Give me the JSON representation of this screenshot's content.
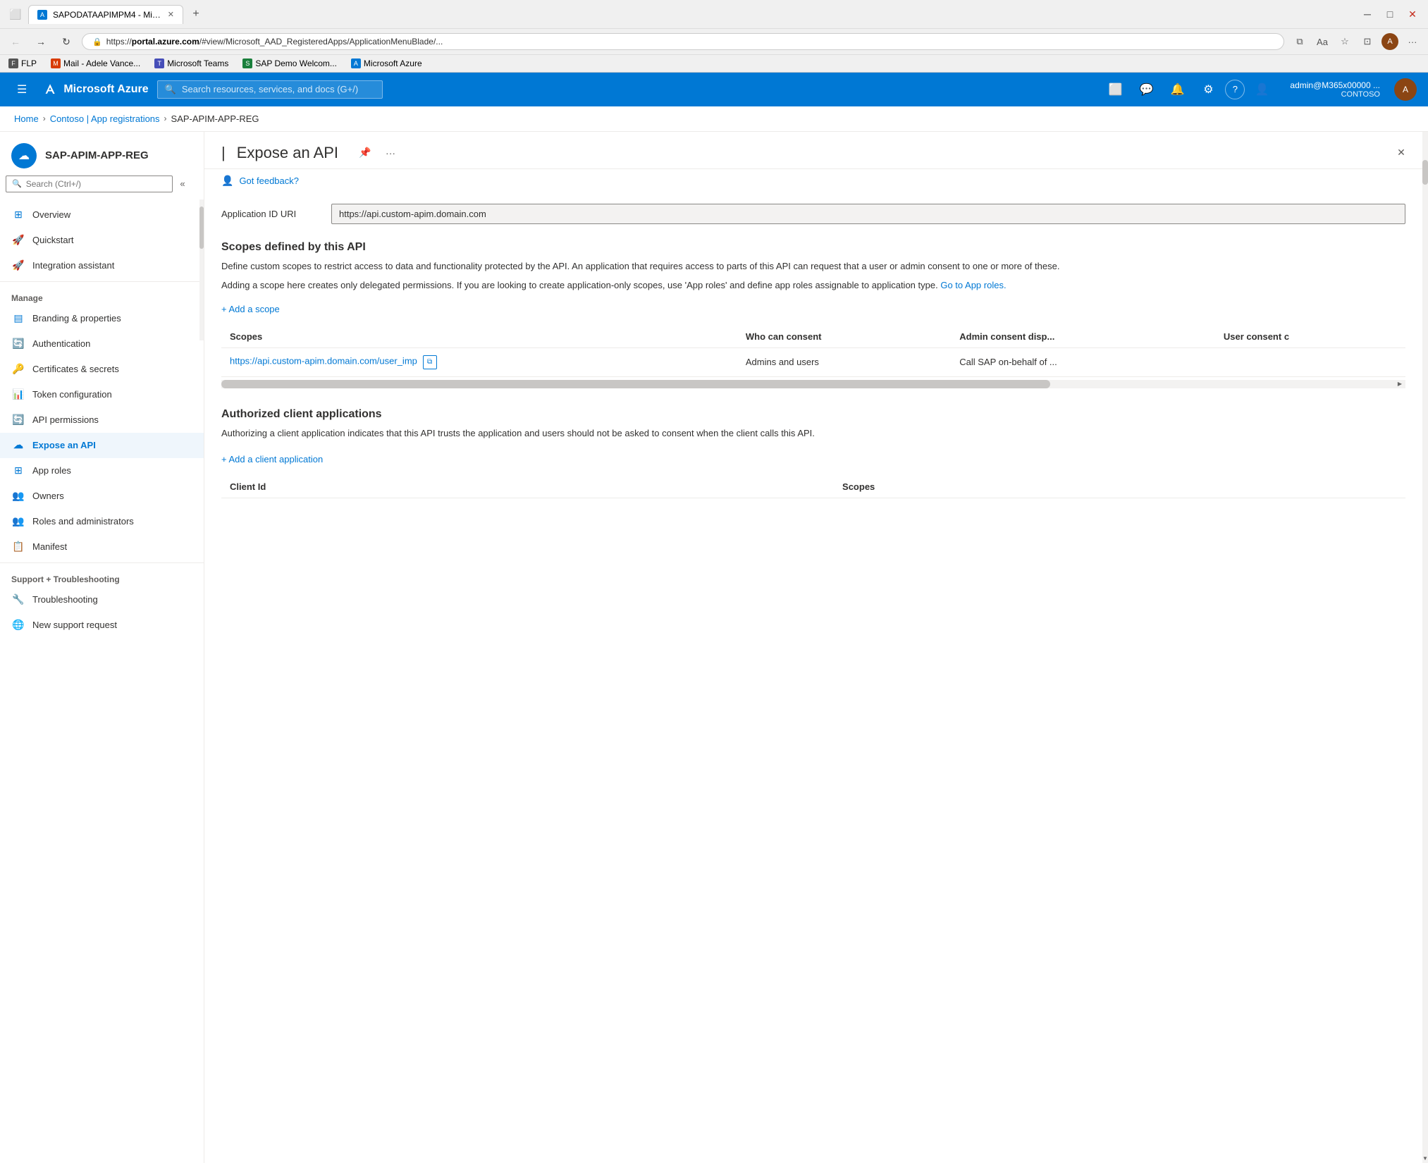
{
  "browser": {
    "tab_title": "SAPODATAAPIMPM4 - Microsof...",
    "tab_favicon": "A",
    "url_prefix": "https://",
    "url_domain": "portal.azure.com",
    "url_path": "/#view/Microsoft_AAD_RegisteredApps/ApplicationMenuBlade/...",
    "new_tab_icon": "+",
    "back_icon": "←",
    "forward_icon": "→",
    "refresh_icon": "↻",
    "lock_icon": "🔒"
  },
  "bookmarks": [
    {
      "id": "flp",
      "label": "FLP",
      "color": "#555"
    },
    {
      "id": "mail",
      "label": "Mail - Adele Vance...",
      "color": "#d83b01"
    },
    {
      "id": "teams",
      "label": "Microsoft Teams",
      "color": "#464eb8"
    },
    {
      "id": "sap",
      "label": "SAP Demo Welcom...",
      "color": "#1a7f3c"
    },
    {
      "id": "azure",
      "label": "Microsoft Azure",
      "color": "#0078d4"
    }
  ],
  "azure_header": {
    "logo_text": "Microsoft Azure",
    "search_placeholder": "Search resources, services, and docs (G+/)",
    "user_display": "admin@M365x00000 ...",
    "tenant": "CONTOSO",
    "icons": {
      "cloud": "⬜",
      "feedback": "💬",
      "bell": "🔔",
      "gear": "⚙",
      "help": "?",
      "people": "👤"
    }
  },
  "breadcrumb": {
    "home": "Home",
    "app_registrations": "Contoso | App registrations",
    "current": "SAP-APIM-APP-REG"
  },
  "sidebar": {
    "app_name": "SAP-APIM-APP-REG",
    "search_placeholder": "Search (Ctrl+/)",
    "collapse_icon": "«",
    "nav_items": [
      {
        "id": "overview",
        "label": "Overview",
        "icon": "⊞",
        "icon_color": "#0078d4",
        "active": false
      },
      {
        "id": "quickstart",
        "label": "Quickstart",
        "icon": "🚀",
        "icon_color": "#0078d4",
        "active": false
      },
      {
        "id": "integration",
        "label": "Integration assistant",
        "icon": "🚀",
        "icon_color": "#e74c3c",
        "active": false
      }
    ],
    "manage_section": "Manage",
    "manage_items": [
      {
        "id": "branding",
        "label": "Branding & properties",
        "icon": "▤",
        "icon_color": "#0078d4",
        "active": false
      },
      {
        "id": "authentication",
        "label": "Authentication",
        "icon": "🔄",
        "icon_color": "#0078d4",
        "active": false
      },
      {
        "id": "certificates",
        "label": "Certificates & secrets",
        "icon": "🔑",
        "icon_color": "#f5a623",
        "active": false
      },
      {
        "id": "token",
        "label": "Token configuration",
        "icon": "📊",
        "icon_color": "#0078d4",
        "active": false
      },
      {
        "id": "api_permissions",
        "label": "API permissions",
        "icon": "🔄",
        "icon_color": "#0078d4",
        "active": false
      },
      {
        "id": "expose_api",
        "label": "Expose an API",
        "icon": "☁",
        "icon_color": "#0078d4",
        "active": true
      },
      {
        "id": "app_roles",
        "label": "App roles",
        "icon": "⊞",
        "icon_color": "#0078d4",
        "active": false
      },
      {
        "id": "owners",
        "label": "Owners",
        "icon": "👥",
        "icon_color": "#0078d4",
        "active": false
      },
      {
        "id": "roles_admins",
        "label": "Roles and administrators",
        "icon": "👥",
        "icon_color": "#27ae60",
        "active": false
      },
      {
        "id": "manifest",
        "label": "Manifest",
        "icon": "📋",
        "icon_color": "#0078d4",
        "active": false
      }
    ],
    "support_section": "Support + Troubleshooting",
    "support_items": [
      {
        "id": "troubleshooting",
        "label": "Troubleshooting",
        "icon": "🔧",
        "icon_color": "#605e5c",
        "active": false
      },
      {
        "id": "new_support",
        "label": "New support request",
        "icon": "🌐",
        "icon_color": "#0078d4",
        "active": false
      }
    ]
  },
  "page": {
    "title": "Expose an API",
    "pin_icon": "📌",
    "more_icon": "...",
    "close_icon": "✕",
    "feedback_text": "Got feedback?",
    "feedback_icon": "👤"
  },
  "content": {
    "app_id_uri_label": "Application ID URI",
    "app_id_uri_value": "https://api.custom-apim.domain.com",
    "scopes_title": "Scopes defined by this API",
    "scopes_desc1": "Define custom scopes to restrict access to data and functionality protected by the API. An application that requires access to parts of this API can request that a user or admin consent to one or more of these.",
    "scopes_desc2": "Adding a scope here creates only delegated permissions. If you are looking to create application-only scopes, use 'App roles' and define app roles assignable to application type.",
    "go_to_app_roles_link": "Go to App roles.",
    "add_scope_btn": "+ Add a scope",
    "scopes_table": {
      "columns": [
        "Scopes",
        "Who can consent",
        "Admin consent disp...",
        "User consent c"
      ],
      "rows": [
        {
          "scope_url": "https://api.custom-apim.domain.com/user_imp",
          "who_can_consent": "Admins and users",
          "admin_consent_display": "Call SAP on-behalf of ...",
          "user_consent": ""
        }
      ]
    },
    "auth_clients_title": "Authorized client applications",
    "auth_clients_desc": "Authorizing a client application indicates that this API trusts the application and users should not be asked to consent when the client calls this API.",
    "add_client_btn": "+ Add a client application",
    "clients_table": {
      "columns": [
        "Client Id",
        "Scopes"
      ]
    }
  }
}
